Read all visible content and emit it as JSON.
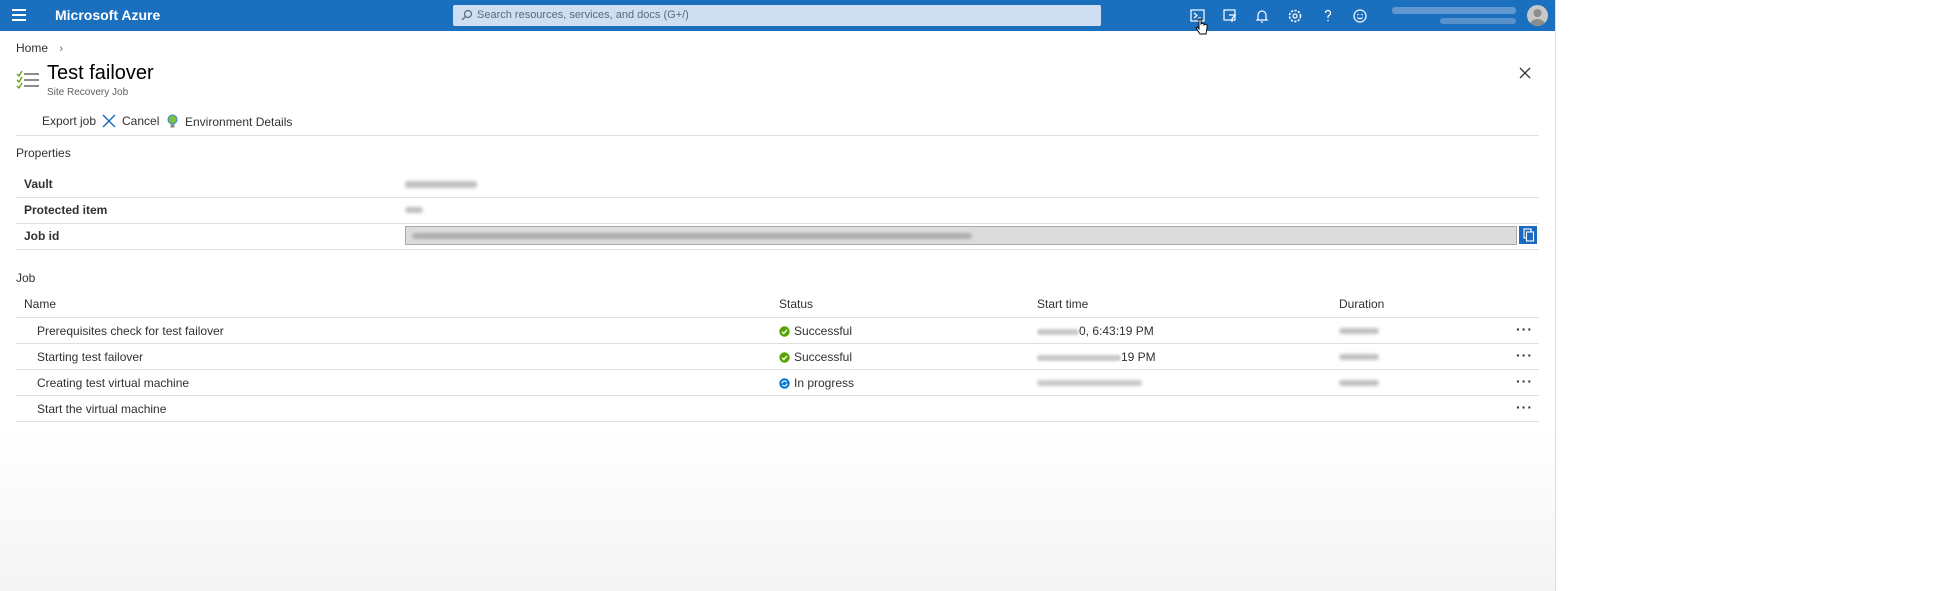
{
  "topbar": {
    "brand": "Microsoft Azure",
    "search_placeholder": "Search resources, services, and docs (G+/)",
    "icons": [
      "cloud-shell-icon",
      "directory-filter-icon",
      "notifications-icon",
      "settings-icon",
      "help-icon",
      "feedback-icon"
    ]
  },
  "breadcrumb": {
    "home": "Home"
  },
  "blade": {
    "title": "Test failover",
    "subtitle": "Site Recovery Job"
  },
  "toolbar": {
    "export_job": "Export job",
    "cancel": "Cancel",
    "environment_details": "Environment Details"
  },
  "properties": {
    "section_label": "Properties",
    "vault_label": "Vault",
    "protected_item_label": "Protected item",
    "job_id_label": "Job id"
  },
  "job": {
    "section_label": "Job",
    "columns": {
      "name": "Name",
      "status": "Status",
      "start_time": "Start time",
      "duration": "Duration"
    },
    "rows": [
      {
        "name": "Prerequisites check for test failover",
        "status": "Successful",
        "status_type": "success",
        "start_time_visible": "0, 6:43:19 PM"
      },
      {
        "name": "Starting test failover",
        "status": "Successful",
        "status_type": "success",
        "start_time_visible": "19 PM"
      },
      {
        "name": "Creating test virtual machine",
        "status": "In progress",
        "status_type": "progress",
        "start_time_visible": ""
      },
      {
        "name": "Start the virtual machine",
        "status": "",
        "status_type": "none",
        "start_time_visible": ""
      }
    ],
    "more_label": "···"
  },
  "colors": {
    "topbar": "#1b6fbf",
    "success": "#57a300",
    "progress": "#0078d4",
    "copy_button": "#1a6bbf"
  }
}
